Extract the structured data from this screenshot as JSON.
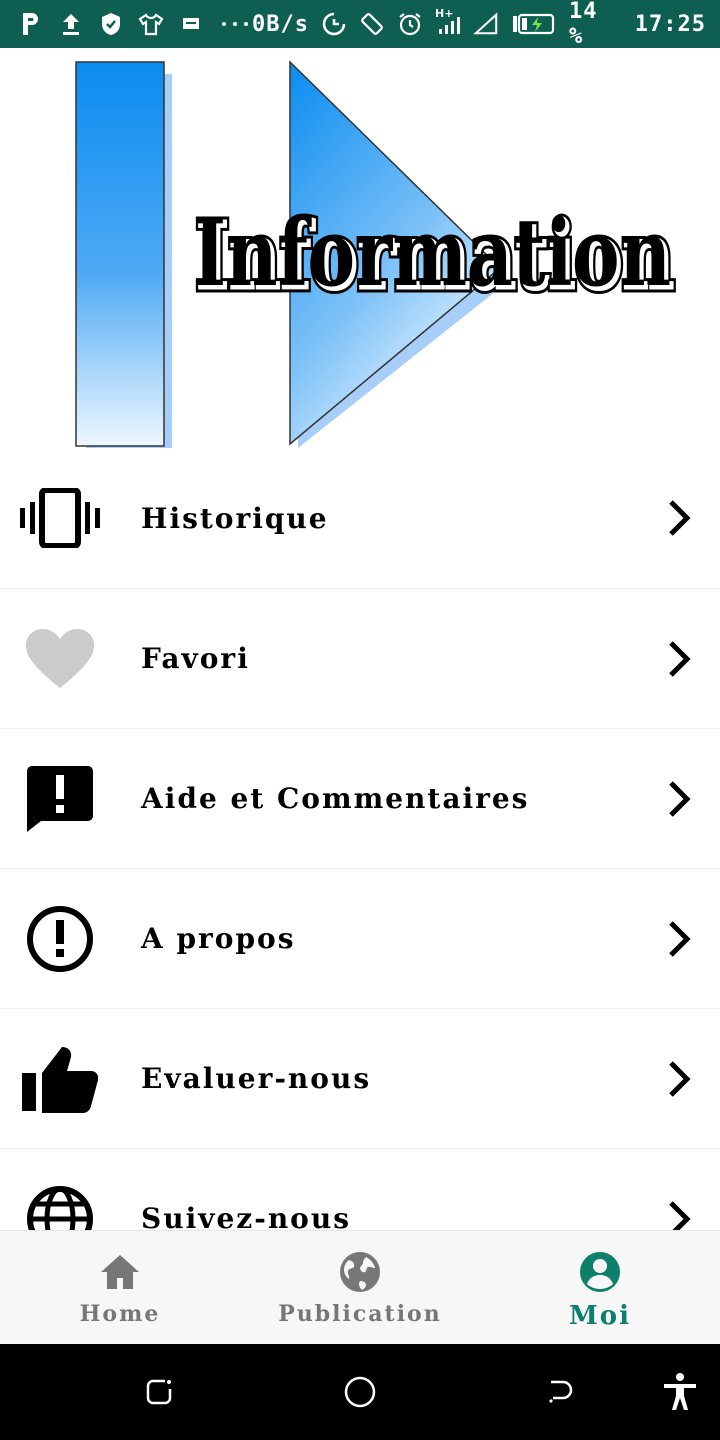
{
  "status_bar": {
    "left_icons": [
      "parking-icon",
      "upload-icon",
      "shield-icon",
      "tshirt-icon",
      "message-icon",
      "more-dots-icon"
    ],
    "speed": "0B/s",
    "battery_percent": "14 %",
    "time": "17:25",
    "right_icons": [
      "data-saver-icon",
      "rotate-icon",
      "alarm-icon",
      "signal-icon",
      "cell-signal-icon",
      "battery-charging-icon"
    ],
    "network_label": "H+"
  },
  "banner": {
    "title": "Information",
    "colors": {
      "primary_blue": "#0a8cf0",
      "light_blue": "#e9f4ff",
      "shadow_blue": "#a7cdf9"
    }
  },
  "menu": {
    "items": [
      {
        "label": "Historique",
        "icon": "vibrate-phone-icon"
      },
      {
        "label": "Favori",
        "icon": "heart-icon"
      },
      {
        "label": "Aide et Commentaires",
        "icon": "feedback-icon"
      },
      {
        "label": "A propos",
        "icon": "info-circle-icon"
      },
      {
        "label": "Evaluer-nous",
        "icon": "thumbs-up-icon"
      },
      {
        "label": "Suivez-nous",
        "icon": "globe-icon"
      }
    ]
  },
  "bottom_nav": {
    "tabs": [
      {
        "label": "Home",
        "icon": "home-icon",
        "active": false
      },
      {
        "label": "Publication",
        "icon": "globe-icon",
        "active": false
      },
      {
        "label": "Moi",
        "icon": "account-icon",
        "active": true
      }
    ],
    "colors": {
      "active": "#0e7f6a",
      "inactive": "#777777"
    }
  },
  "system_nav": {
    "buttons": [
      "recents-icon",
      "home-circle-icon",
      "back-icon",
      "accessibility-icon"
    ]
  },
  "colors": {
    "status_bar_bg": "#0e5f52"
  }
}
